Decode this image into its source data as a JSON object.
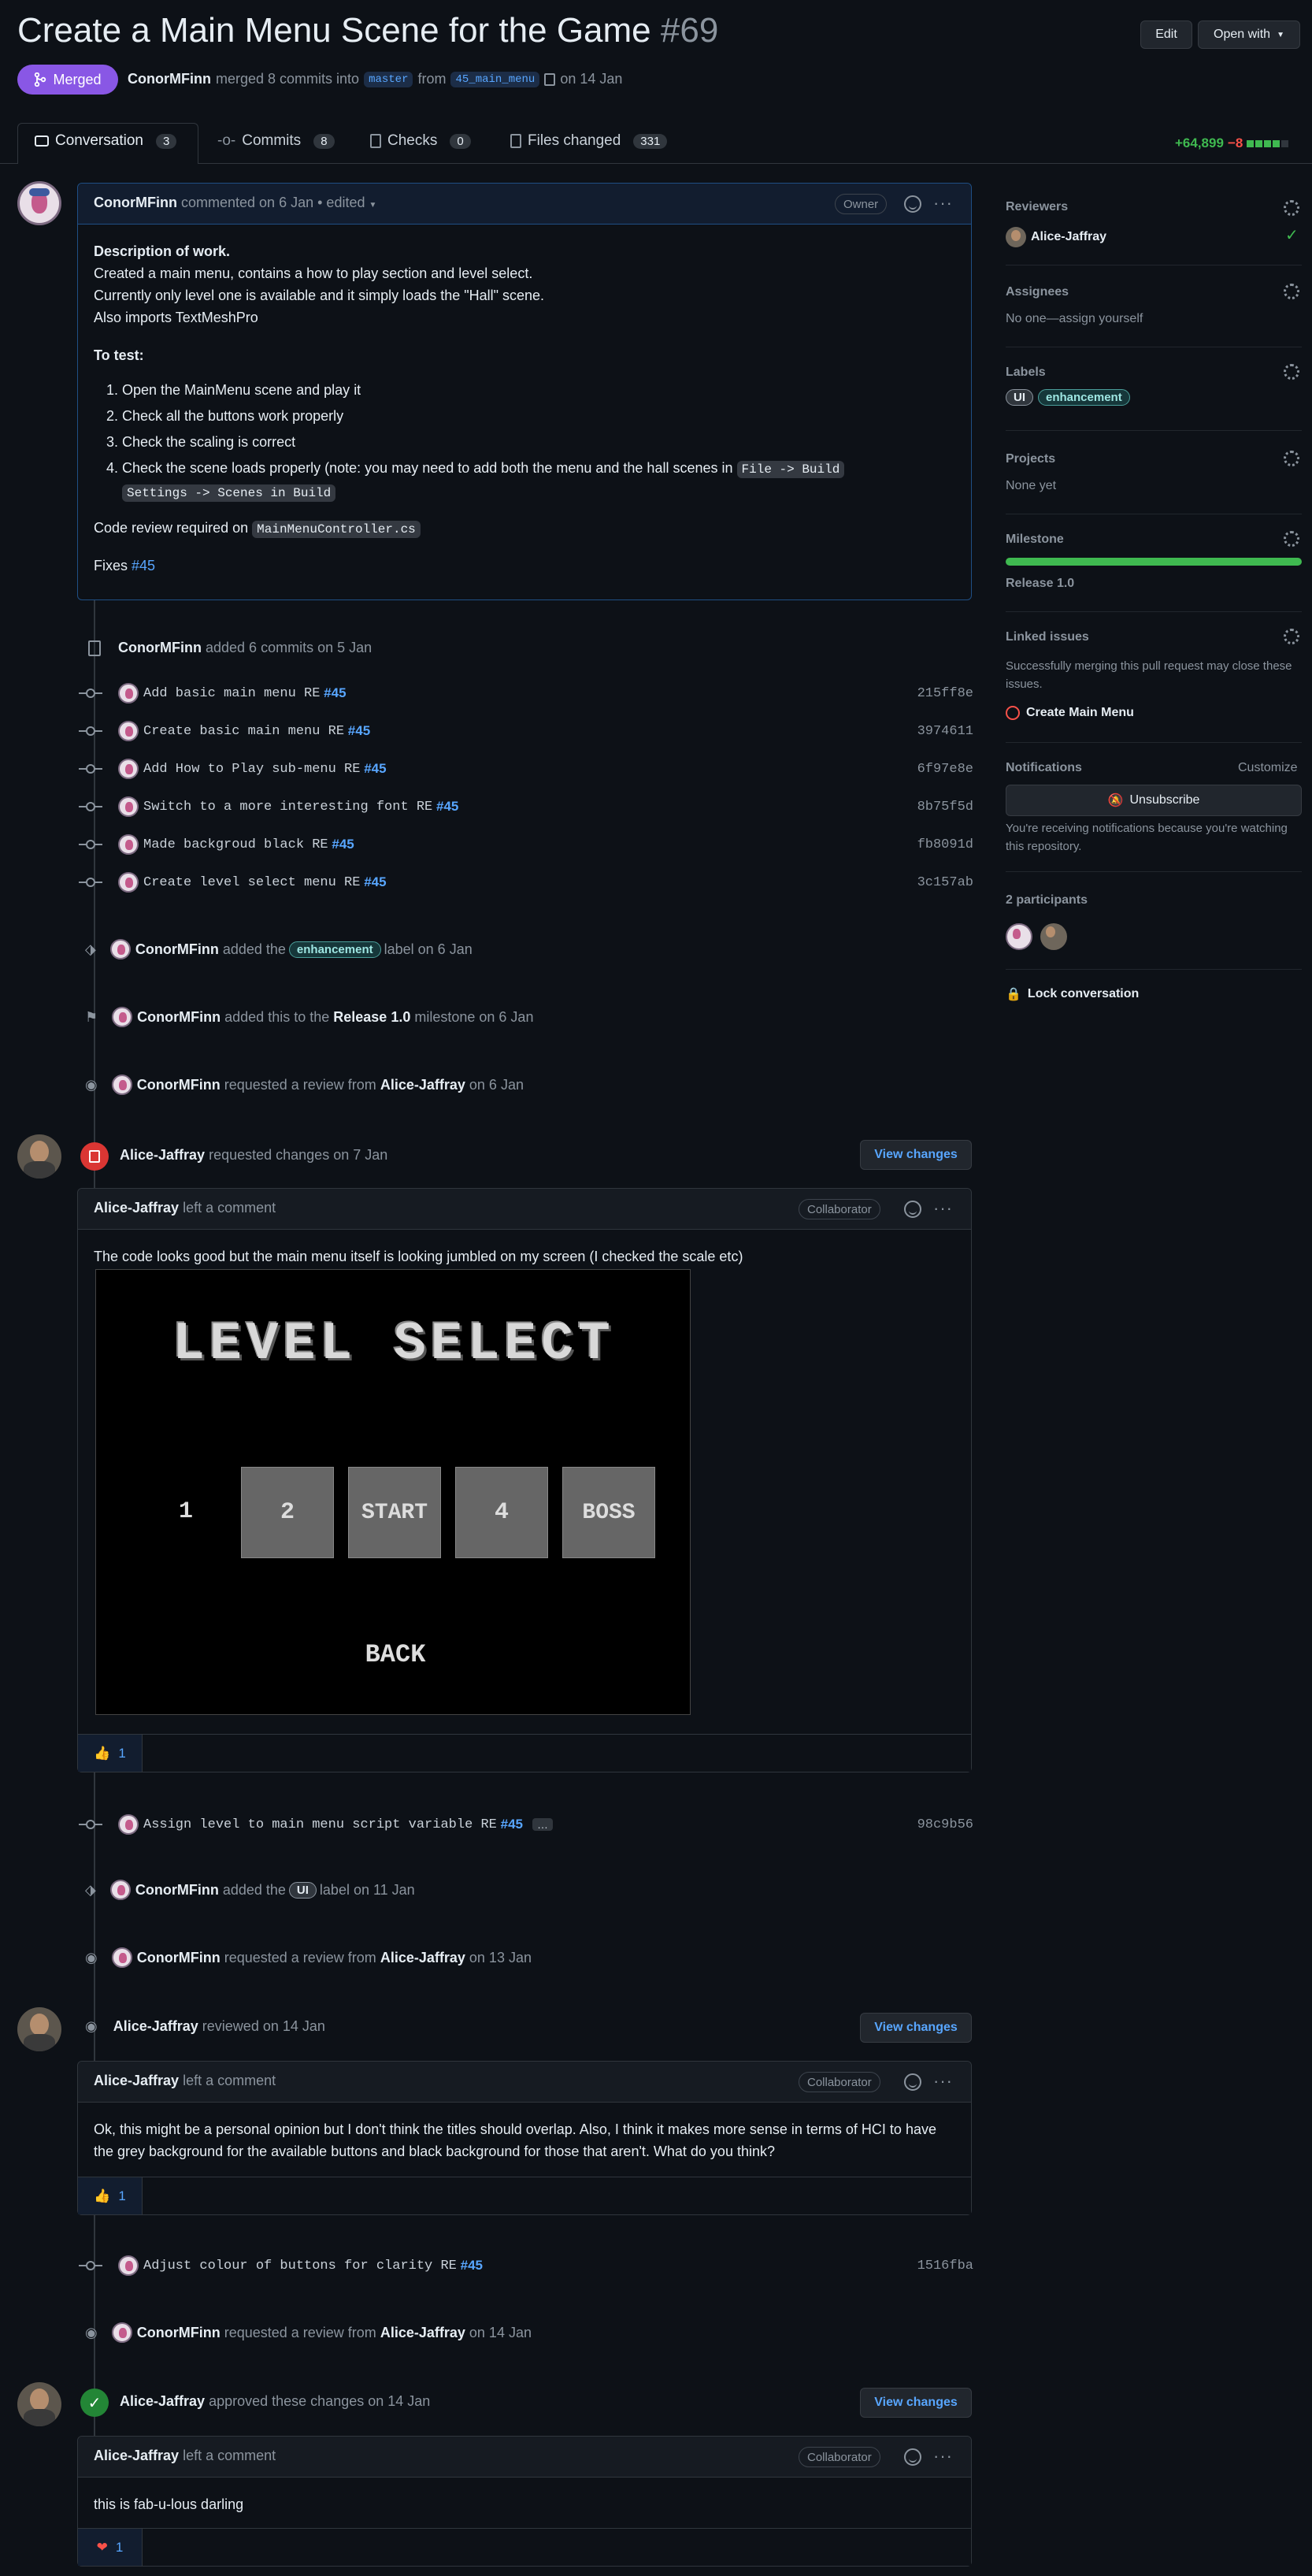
{
  "pr": {
    "title": "Create a Main Menu Scene for the Game",
    "number": "#69",
    "state": "Merged",
    "author": "ConorMFinn",
    "merged_text": "merged 8 commits into",
    "base": "master",
    "from_text": "from",
    "head": "45_main_menu",
    "date_text": "on 14 Jan"
  },
  "header_buttons": {
    "edit": "Edit",
    "open_with": "Open with"
  },
  "tabs": [
    {
      "label": "Conversation",
      "count": "3"
    },
    {
      "label": "Commits",
      "count": "8"
    },
    {
      "label": "Checks",
      "count": "0"
    },
    {
      "label": "Files changed",
      "count": "331"
    }
  ],
  "diffstat": {
    "additions": "+64,899",
    "deletions": "−8"
  },
  "colors": {
    "merged": "#a371f7",
    "accent": "#58a6ff",
    "success": "#3fb950",
    "danger": "#f85149"
  },
  "first_comment": {
    "author": "ConorMFinn",
    "meta": "commented on 6 Jan",
    "edited": "• edited",
    "role": "Owner",
    "desc_heading": "Description of work.",
    "desc_lines": [
      "Created a main menu, contains a how to play section and level select.",
      "Currently only level one is available and it simply loads the \"Hall\" scene.",
      "Also imports TextMeshPro"
    ],
    "test_heading": "To test:",
    "steps": [
      "Open the MainMenu scene and play it",
      "Check all the buttons work properly",
      "Check the scaling is correct",
      "Check the scene loads properly (note: you may need to add both the menu and the hall scenes in"
    ],
    "step4_code1": "File -> Build",
    "step4_code2": "Settings -> Scenes in Build",
    "review_text": "Code review required on",
    "review_code": "MainMenuController.cs",
    "fixes_text": "Fixes",
    "fixes_link": "#45"
  },
  "commits_event": {
    "author": "ConorMFinn",
    "text": "added 6 commits on 5 Jan"
  },
  "commits": [
    {
      "msg": "Add basic main menu RE",
      "ref": "#45",
      "sha": "215ff8e"
    },
    {
      "msg": "Create basic main menu RE",
      "ref": "#45",
      "sha": "3974611"
    },
    {
      "msg": "Add How to Play sub-menu RE",
      "ref": "#45",
      "sha": "6f97e8e"
    },
    {
      "msg": "Switch to a more interesting font RE",
      "ref": "#45",
      "sha": "8b75f5d"
    },
    {
      "msg": "Made backgroud black RE",
      "ref": "#45",
      "sha": "fb8091d"
    },
    {
      "msg": "Create level select menu RE",
      "ref": "#45",
      "sha": "3c157ab"
    }
  ],
  "events": {
    "label1": {
      "author": "ConorMFinn",
      "pre": "added the",
      "label": "enhancement",
      "post": "label on 6 Jan"
    },
    "milestone": {
      "author": "ConorMFinn",
      "pre": "added this to the",
      "milestone": "Release 1.0",
      "post": "milestone on 6 Jan"
    },
    "req1": {
      "author": "ConorMFinn",
      "pre": "requested a review from",
      "who": "Alice-Jaffray",
      "post": "on 6 Jan"
    },
    "changes": {
      "author": "Alice-Jaffray",
      "text": "requested changes on 7 Jan",
      "button": "View changes"
    },
    "commit7": {
      "msg": "Assign level to main menu script variable RE",
      "ref": "#45",
      "more": "…",
      "sha": "98c9b56"
    },
    "label2": {
      "author": "ConorMFinn",
      "pre": "added the",
      "label": "UI",
      "post": "label on 11 Jan"
    },
    "req2": {
      "author": "ConorMFinn",
      "pre": "requested a review from",
      "who": "Alice-Jaffray",
      "post": "on 13 Jan"
    },
    "reviewed": {
      "author": "Alice-Jaffray",
      "text": "reviewed on 14 Jan",
      "button": "View changes"
    },
    "commit8": {
      "msg": "Adjust colour of buttons for clarity RE",
      "ref": "#45",
      "sha": "1516fba"
    },
    "req3": {
      "author": "ConorMFinn",
      "pre": "requested a review from",
      "who": "Alice-Jaffray",
      "post": "on 14 Jan"
    },
    "approved": {
      "author": "Alice-Jaffray",
      "text": "approved these changes on 14 Jan",
      "button": "View changes"
    }
  },
  "review1": {
    "author": "Alice-Jaffray",
    "meta": "left a comment",
    "role": "Collaborator",
    "text": "The code looks good but the main menu itself is looking jumbled on my screen (I checked the scale etc)",
    "reaction": "1",
    "game": {
      "title": "LEVEL SELECT",
      "buttons": [
        "1",
        "2",
        "START",
        "4",
        "BOSS"
      ],
      "back": "BACK"
    }
  },
  "review2": {
    "author": "Alice-Jaffray",
    "meta": "left a comment",
    "role": "Collaborator",
    "text": "Ok, this might be a personal opinion but I don't think the titles should overlap. Also, I think it makes more sense in terms of HCI to have the grey background for the available buttons and black background for those that aren't. What do you think?",
    "reaction": "1"
  },
  "review3": {
    "author": "Alice-Jaffray",
    "meta": "left a comment",
    "role": "Collaborator",
    "text": "this is fab-u-lous darling",
    "reaction": "1"
  },
  "sidebar": {
    "reviewers": {
      "heading": "Reviewers",
      "name": "Alice-Jaffray"
    },
    "assignees": {
      "heading": "Assignees",
      "value": "No one—assign yourself"
    },
    "labels": {
      "heading": "Labels",
      "items": [
        "UI",
        "enhancement"
      ]
    },
    "projects": {
      "heading": "Projects",
      "value": "None yet"
    },
    "milestone": {
      "heading": "Milestone",
      "value": "Release 1.0",
      "progress": 1.0
    },
    "linked": {
      "heading": "Linked issues",
      "text": "Successfully merging this pull request may close these issues.",
      "issue": "Create Main Menu"
    },
    "notifications": {
      "heading": "Notifications",
      "customize": "Customize",
      "button": "Unsubscribe",
      "text": "You're receiving notifications because you're watching this repository."
    },
    "participants": {
      "heading": "2 participants"
    },
    "lock": "Lock conversation"
  }
}
